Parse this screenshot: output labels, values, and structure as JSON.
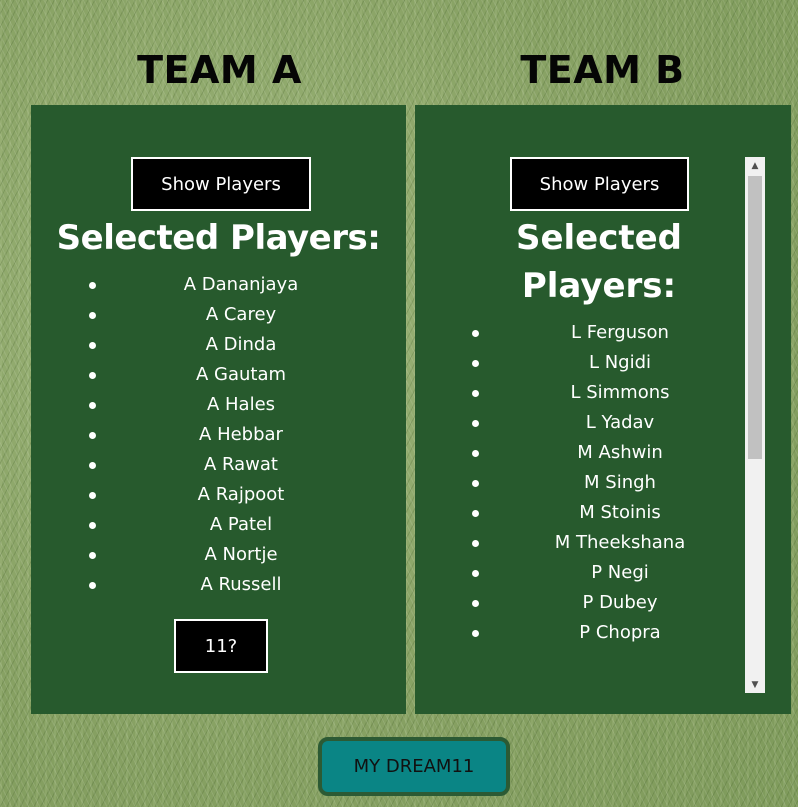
{
  "teams": {
    "a": {
      "title": "TEAM A",
      "show_button": "Show Players",
      "heading": "Selected Players:",
      "players": [
        "A Dananjaya",
        "A Carey",
        "A Dinda",
        "A Gautam",
        "A Hales",
        "A Hebbar",
        "A Rawat",
        "A Rajpoot",
        "A Patel",
        "A Nortje",
        "A Russell"
      ],
      "count_button": "11?"
    },
    "b": {
      "title": "TEAM B",
      "show_button": "Show Players",
      "heading_line1": "Selected",
      "heading_line2": "Players:",
      "players": [
        "L Ferguson",
        "L Ngidi",
        "L Simmons",
        "L Yadav",
        "M Ashwin",
        "M Singh",
        "M Stoinis",
        "M Theekshana",
        "P Negi",
        "P Dubey",
        "P Chopra"
      ]
    }
  },
  "footer": {
    "dream_button": "MY DREAM11"
  },
  "colors": {
    "panel": "#275a2d",
    "button": "#000000",
    "dream_button": "#0a8585",
    "grass": "#8fa86a"
  },
  "icons": {
    "scroll_up": "triangle-up",
    "scroll_down": "triangle-down"
  }
}
